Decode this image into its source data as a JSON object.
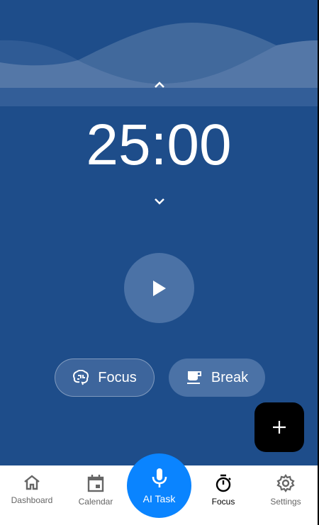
{
  "timer": {
    "display": "25:00"
  },
  "modes": [
    {
      "label": "Focus",
      "icon": "brain-icon"
    },
    {
      "label": "Break",
      "icon": "coffee-icon"
    }
  ],
  "nav": {
    "items": [
      {
        "label": "Dashboard",
        "icon": "home-icon"
      },
      {
        "label": "Calendar",
        "icon": "calendar-icon"
      },
      {
        "label": "AI Task",
        "icon": "microphone-icon"
      },
      {
        "label": "Focus",
        "icon": "stopwatch-icon",
        "active": true
      },
      {
        "label": "Settings",
        "icon": "gear-icon"
      }
    ]
  },
  "colors": {
    "background": "#1e4d8a",
    "accent": "#0a84ff",
    "fab": "#000000"
  }
}
